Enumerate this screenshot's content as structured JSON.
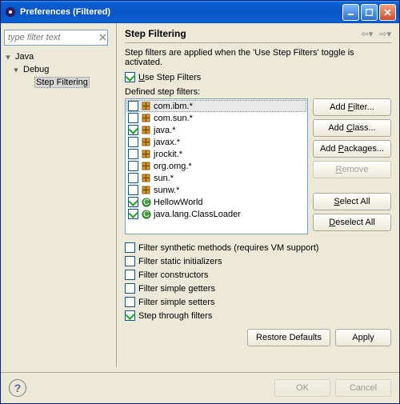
{
  "window": {
    "title": "Preferences (Filtered)"
  },
  "filter": {
    "placeholder": "type filter text"
  },
  "tree": {
    "items": [
      {
        "label": "Java",
        "expanded": true,
        "level": 0
      },
      {
        "label": "Debug",
        "expanded": true,
        "level": 1
      },
      {
        "label": "Step Filtering",
        "selected": true,
        "level": 2
      }
    ]
  },
  "section": {
    "title": "Step Filtering",
    "description": "Step filters are applied when the 'Use Step Filters' toggle is activated.",
    "use_step_filters_label": "Use Step Filters",
    "defined_label": "Defined step filters:"
  },
  "filters": [
    {
      "checked": false,
      "icon": "package",
      "label": "com.ibm.*",
      "selected": true
    },
    {
      "checked": false,
      "icon": "package",
      "label": "com.sun.*"
    },
    {
      "checked": true,
      "icon": "package",
      "label": "java.*"
    },
    {
      "checked": false,
      "icon": "package",
      "label": "javax.*"
    },
    {
      "checked": false,
      "icon": "package",
      "label": "jrockit.*"
    },
    {
      "checked": false,
      "icon": "package",
      "label": "org.omg.*"
    },
    {
      "checked": false,
      "icon": "package",
      "label": "sun.*"
    },
    {
      "checked": false,
      "icon": "package",
      "label": "sunw.*"
    },
    {
      "checked": true,
      "icon": "class",
      "label": "HellowWorld"
    },
    {
      "checked": true,
      "icon": "class",
      "label": "java.lang.ClassLoader"
    }
  ],
  "buttons": {
    "add_filter": "Add Filter...",
    "add_class": "Add Class...",
    "add_packages": "Add Packages...",
    "remove": "Remove",
    "select_all": "Select All",
    "deselect_all": "Deselect All",
    "restore_defaults": "Restore Defaults",
    "apply": "Apply",
    "ok": "OK",
    "cancel": "Cancel"
  },
  "options": {
    "synthetic": {
      "checked": false,
      "label": "Filter synthetic methods (requires VM support)"
    },
    "static_init": {
      "checked": false,
      "label": "Filter static initializers"
    },
    "constructors": {
      "checked": false,
      "label": "Filter constructors"
    },
    "getters": {
      "checked": false,
      "label": "Filter simple getters"
    },
    "setters": {
      "checked": false,
      "label": "Filter simple setters"
    },
    "step_through": {
      "checked": true,
      "label": "Step through filters"
    }
  }
}
